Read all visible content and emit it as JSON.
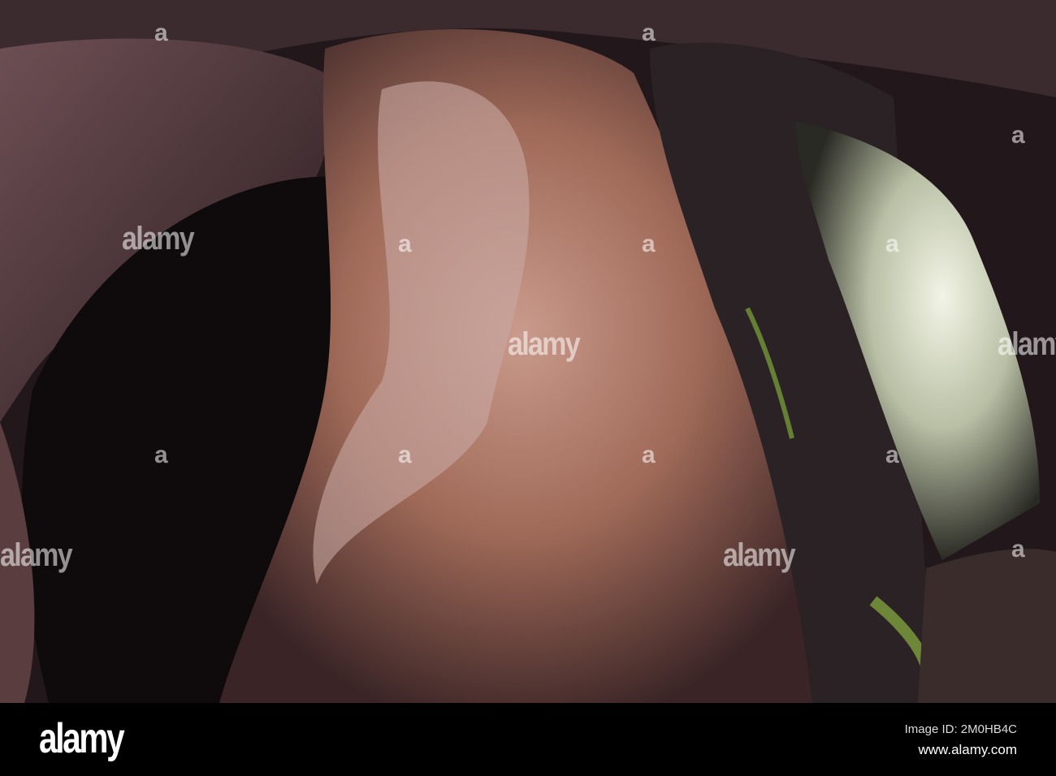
{
  "photo": {
    "subject": "cave interior",
    "watermark_text": "alamy",
    "watermark_icon": "a",
    "colors": {
      "rock": "#b07a6a",
      "shadow": "#1a1214",
      "light_opening": "#e8ecd8",
      "moss": "#7fa83a"
    }
  },
  "footer": {
    "logo": "alamy",
    "image_id": "Image ID: 2M0HB4C",
    "url": "www.alamy.com"
  }
}
